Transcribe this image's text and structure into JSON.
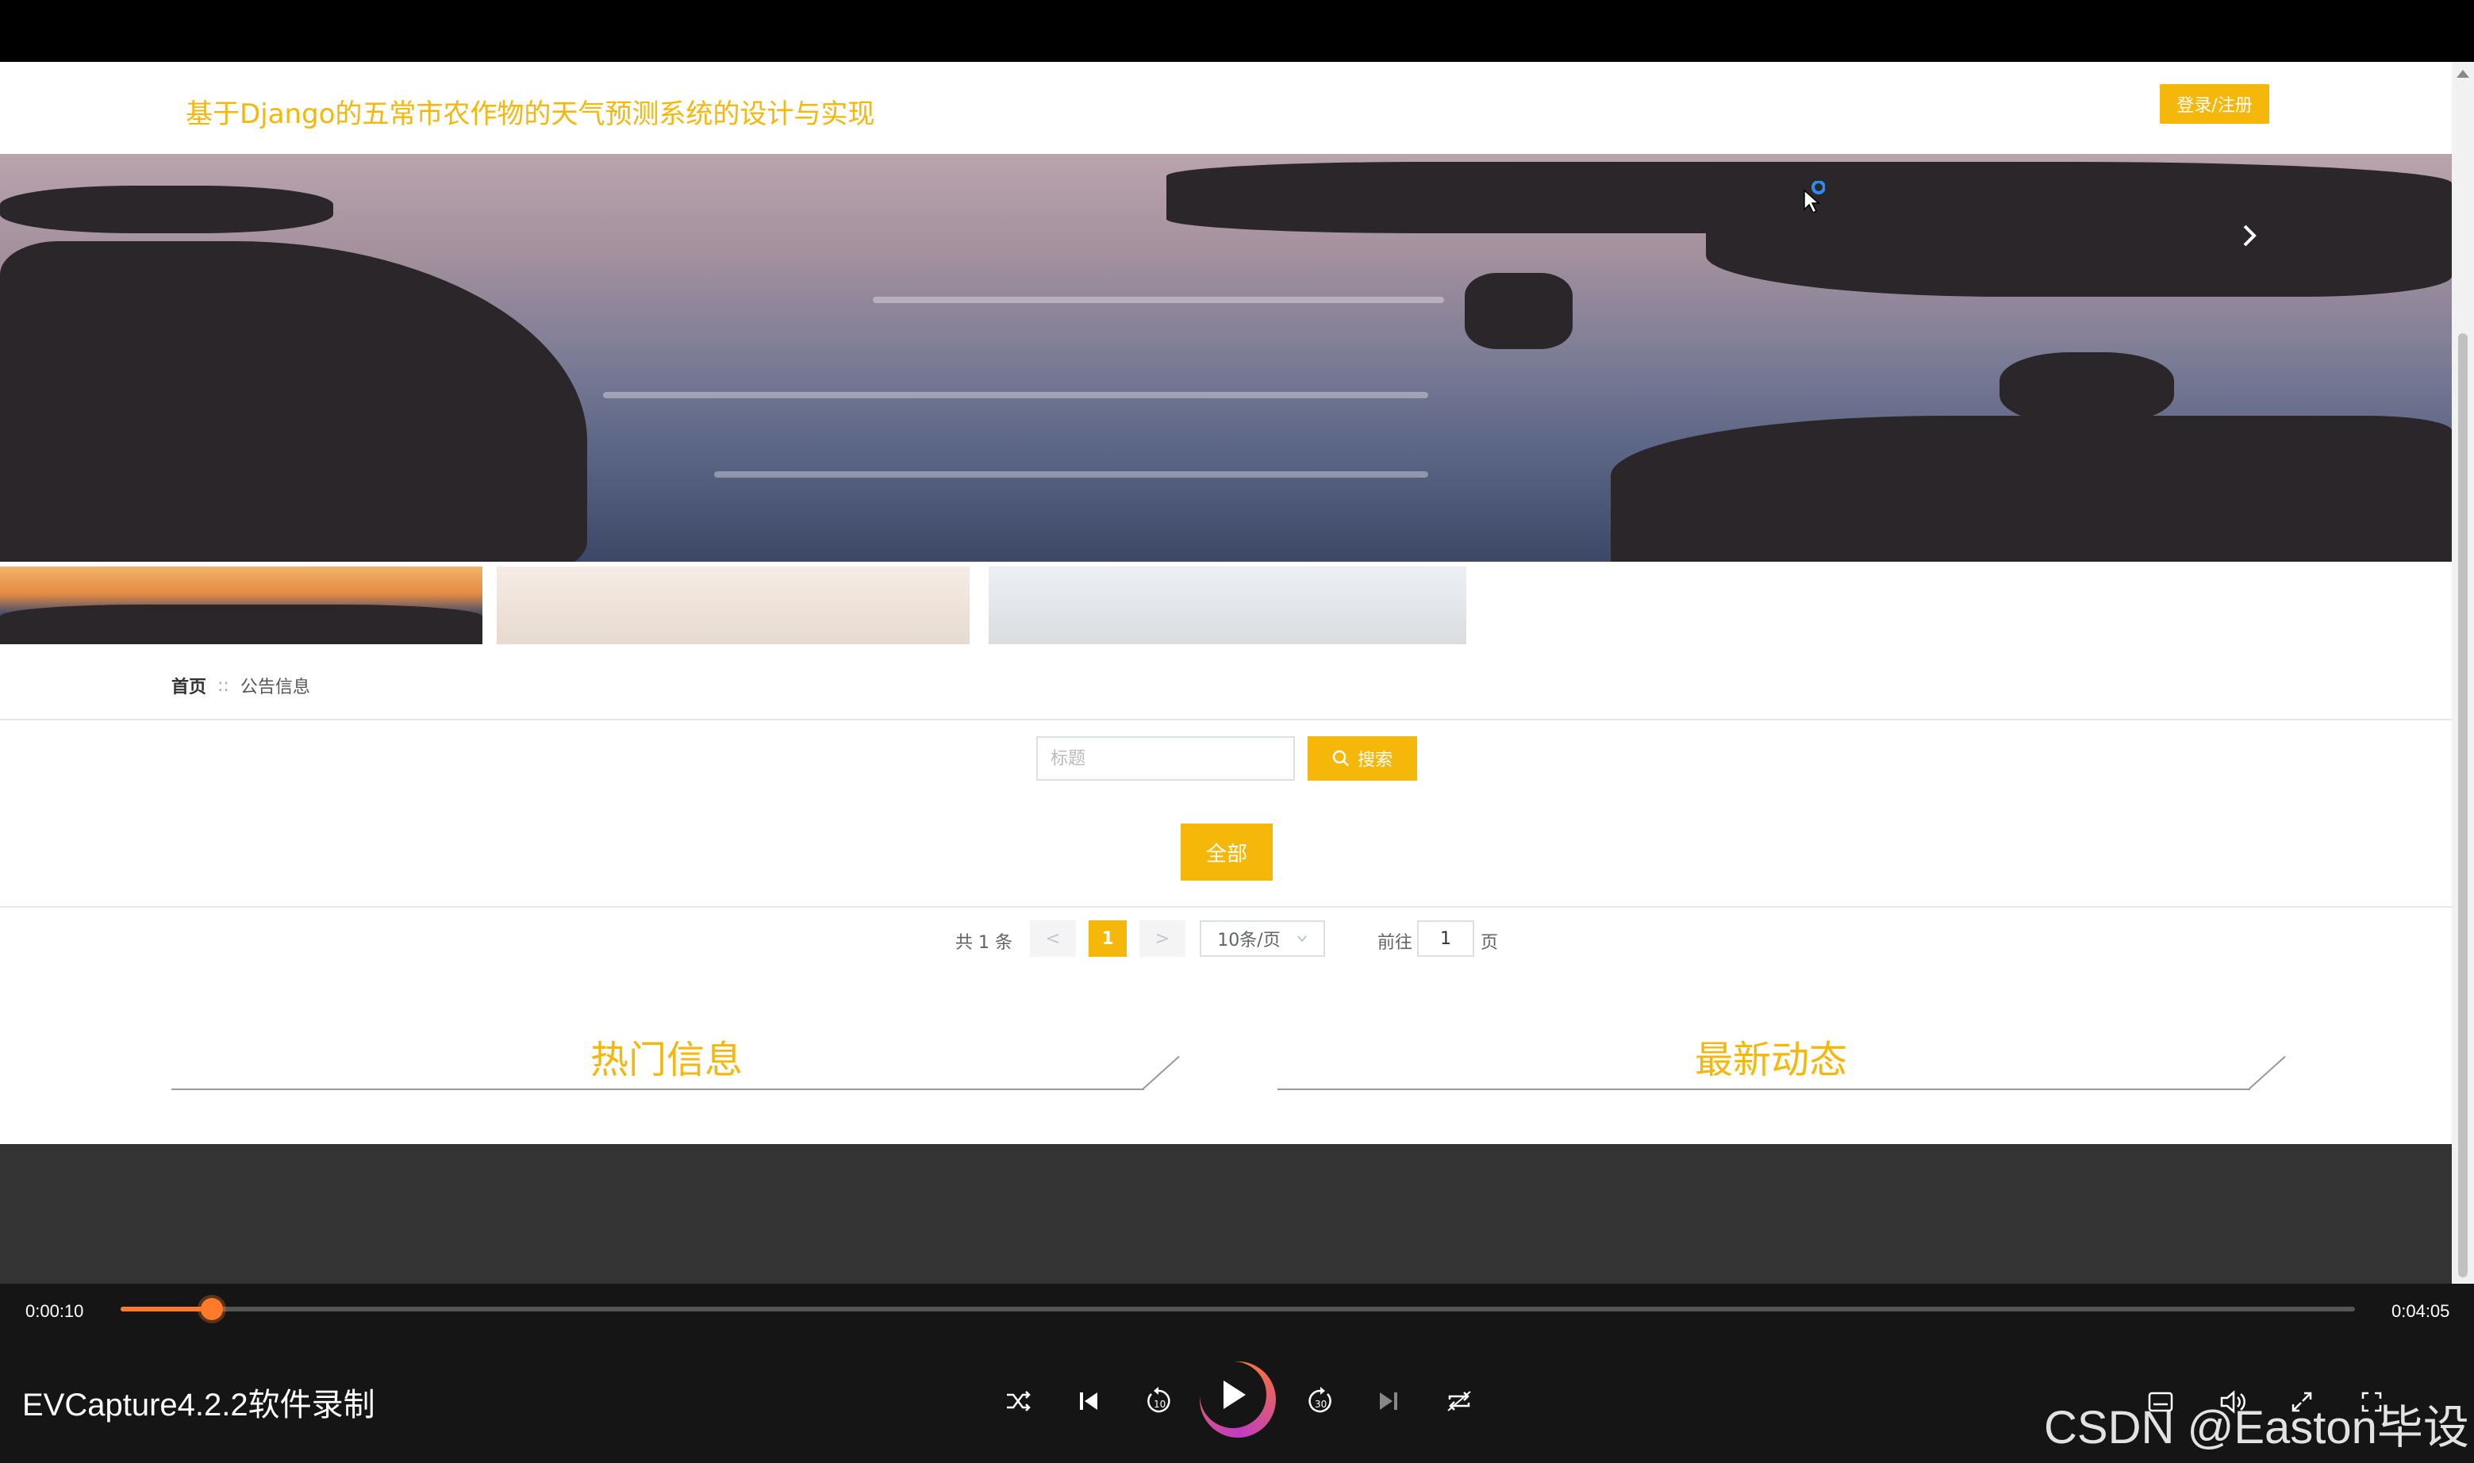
{
  "header": {
    "site_title": "基于Django的五常市农作物的天气预测系统的设计与实现",
    "login_label": "登录/注册"
  },
  "breadcrumb": {
    "home": "首页",
    "separator": "::",
    "current": "公告信息"
  },
  "search": {
    "placeholder": "标题",
    "button_label": "搜索"
  },
  "filter": {
    "all_label": "全部"
  },
  "pagination": {
    "total_text": "共 1 条",
    "prev": "<",
    "current_page": "1",
    "next": ">",
    "page_size": "10条/页",
    "goto_label": "前往",
    "goto_value": "1",
    "goto_unit": "页"
  },
  "sections": {
    "hot_title": "热门信息",
    "news_title": "最新动态"
  },
  "player": {
    "time_current": "0:00:10",
    "time_total": "0:04:05",
    "progress": 0.041,
    "app_name": "EVCapture4.2.2软件录制"
  },
  "watermark": "CSDN @Easton毕设",
  "colors": {
    "accent": "#f5b70a",
    "footer": "#333333",
    "player_accent": "#ff7a2a"
  }
}
